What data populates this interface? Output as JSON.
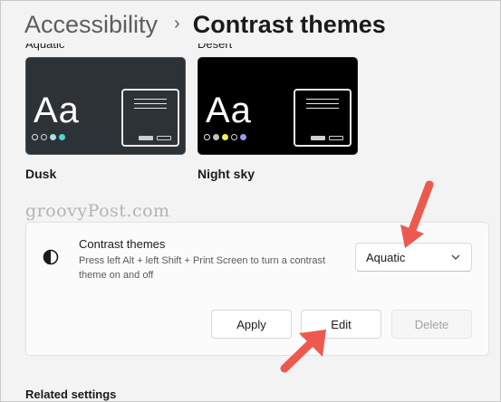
{
  "header": {
    "parent": "Accessibility",
    "separator": "›",
    "current": "Contrast themes"
  },
  "themes": [
    {
      "name": "Aquatic",
      "sample": "Aa",
      "dots": [
        "#e8e8e8",
        "#c8d7df",
        "#a9dfe6",
        "#4fd7d3"
      ]
    },
    {
      "name": "Desert",
      "sample": "Aa",
      "dots": [
        "#e8e8e8",
        "#c0c0c0",
        "#f5f040",
        "#d0d0d0"
      ]
    },
    {
      "name": "Dusk"
    },
    {
      "name": "Night sky"
    }
  ],
  "watermark": "groovyPost.com",
  "setting": {
    "title": "Contrast themes",
    "description": "Press left Alt + left Shift + Print Screen to turn a contrast theme on and off",
    "dropdown_value": "Aquatic"
  },
  "buttons": {
    "apply": "Apply",
    "edit": "Edit",
    "delete": "Delete"
  },
  "related": "Related settings",
  "colors": {
    "annotation_arrow": "#ec5a4f",
    "dusk_card": "#2d3236",
    "night_sky_card": "#000000"
  }
}
